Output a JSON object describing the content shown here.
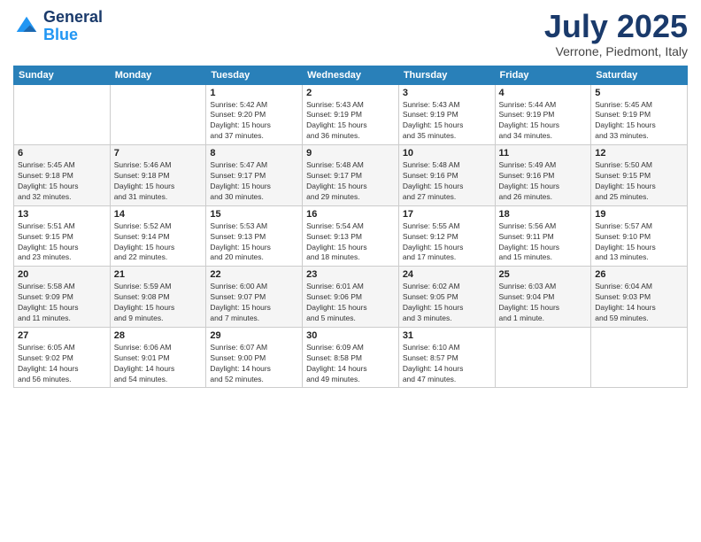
{
  "logo": {
    "line1": "General",
    "line2": "Blue"
  },
  "title": "July 2025",
  "subtitle": "Verrone, Piedmont, Italy",
  "days_of_week": [
    "Sunday",
    "Monday",
    "Tuesday",
    "Wednesday",
    "Thursday",
    "Friday",
    "Saturday"
  ],
  "weeks": [
    [
      {
        "day": "",
        "info": ""
      },
      {
        "day": "",
        "info": ""
      },
      {
        "day": "1",
        "info": "Sunrise: 5:42 AM\nSunset: 9:20 PM\nDaylight: 15 hours\nand 37 minutes."
      },
      {
        "day": "2",
        "info": "Sunrise: 5:43 AM\nSunset: 9:19 PM\nDaylight: 15 hours\nand 36 minutes."
      },
      {
        "day": "3",
        "info": "Sunrise: 5:43 AM\nSunset: 9:19 PM\nDaylight: 15 hours\nand 35 minutes."
      },
      {
        "day": "4",
        "info": "Sunrise: 5:44 AM\nSunset: 9:19 PM\nDaylight: 15 hours\nand 34 minutes."
      },
      {
        "day": "5",
        "info": "Sunrise: 5:45 AM\nSunset: 9:19 PM\nDaylight: 15 hours\nand 33 minutes."
      }
    ],
    [
      {
        "day": "6",
        "info": "Sunrise: 5:45 AM\nSunset: 9:18 PM\nDaylight: 15 hours\nand 32 minutes."
      },
      {
        "day": "7",
        "info": "Sunrise: 5:46 AM\nSunset: 9:18 PM\nDaylight: 15 hours\nand 31 minutes."
      },
      {
        "day": "8",
        "info": "Sunrise: 5:47 AM\nSunset: 9:17 PM\nDaylight: 15 hours\nand 30 minutes."
      },
      {
        "day": "9",
        "info": "Sunrise: 5:48 AM\nSunset: 9:17 PM\nDaylight: 15 hours\nand 29 minutes."
      },
      {
        "day": "10",
        "info": "Sunrise: 5:48 AM\nSunset: 9:16 PM\nDaylight: 15 hours\nand 27 minutes."
      },
      {
        "day": "11",
        "info": "Sunrise: 5:49 AM\nSunset: 9:16 PM\nDaylight: 15 hours\nand 26 minutes."
      },
      {
        "day": "12",
        "info": "Sunrise: 5:50 AM\nSunset: 9:15 PM\nDaylight: 15 hours\nand 25 minutes."
      }
    ],
    [
      {
        "day": "13",
        "info": "Sunrise: 5:51 AM\nSunset: 9:15 PM\nDaylight: 15 hours\nand 23 minutes."
      },
      {
        "day": "14",
        "info": "Sunrise: 5:52 AM\nSunset: 9:14 PM\nDaylight: 15 hours\nand 22 minutes."
      },
      {
        "day": "15",
        "info": "Sunrise: 5:53 AM\nSunset: 9:13 PM\nDaylight: 15 hours\nand 20 minutes."
      },
      {
        "day": "16",
        "info": "Sunrise: 5:54 AM\nSunset: 9:13 PM\nDaylight: 15 hours\nand 18 minutes."
      },
      {
        "day": "17",
        "info": "Sunrise: 5:55 AM\nSunset: 9:12 PM\nDaylight: 15 hours\nand 17 minutes."
      },
      {
        "day": "18",
        "info": "Sunrise: 5:56 AM\nSunset: 9:11 PM\nDaylight: 15 hours\nand 15 minutes."
      },
      {
        "day": "19",
        "info": "Sunrise: 5:57 AM\nSunset: 9:10 PM\nDaylight: 15 hours\nand 13 minutes."
      }
    ],
    [
      {
        "day": "20",
        "info": "Sunrise: 5:58 AM\nSunset: 9:09 PM\nDaylight: 15 hours\nand 11 minutes."
      },
      {
        "day": "21",
        "info": "Sunrise: 5:59 AM\nSunset: 9:08 PM\nDaylight: 15 hours\nand 9 minutes."
      },
      {
        "day": "22",
        "info": "Sunrise: 6:00 AM\nSunset: 9:07 PM\nDaylight: 15 hours\nand 7 minutes."
      },
      {
        "day": "23",
        "info": "Sunrise: 6:01 AM\nSunset: 9:06 PM\nDaylight: 15 hours\nand 5 minutes."
      },
      {
        "day": "24",
        "info": "Sunrise: 6:02 AM\nSunset: 9:05 PM\nDaylight: 15 hours\nand 3 minutes."
      },
      {
        "day": "25",
        "info": "Sunrise: 6:03 AM\nSunset: 9:04 PM\nDaylight: 15 hours\nand 1 minute."
      },
      {
        "day": "26",
        "info": "Sunrise: 6:04 AM\nSunset: 9:03 PM\nDaylight: 14 hours\nand 59 minutes."
      }
    ],
    [
      {
        "day": "27",
        "info": "Sunrise: 6:05 AM\nSunset: 9:02 PM\nDaylight: 14 hours\nand 56 minutes."
      },
      {
        "day": "28",
        "info": "Sunrise: 6:06 AM\nSunset: 9:01 PM\nDaylight: 14 hours\nand 54 minutes."
      },
      {
        "day": "29",
        "info": "Sunrise: 6:07 AM\nSunset: 9:00 PM\nDaylight: 14 hours\nand 52 minutes."
      },
      {
        "day": "30",
        "info": "Sunrise: 6:09 AM\nSunset: 8:58 PM\nDaylight: 14 hours\nand 49 minutes."
      },
      {
        "day": "31",
        "info": "Sunrise: 6:10 AM\nSunset: 8:57 PM\nDaylight: 14 hours\nand 47 minutes."
      },
      {
        "day": "",
        "info": ""
      },
      {
        "day": "",
        "info": ""
      }
    ]
  ]
}
